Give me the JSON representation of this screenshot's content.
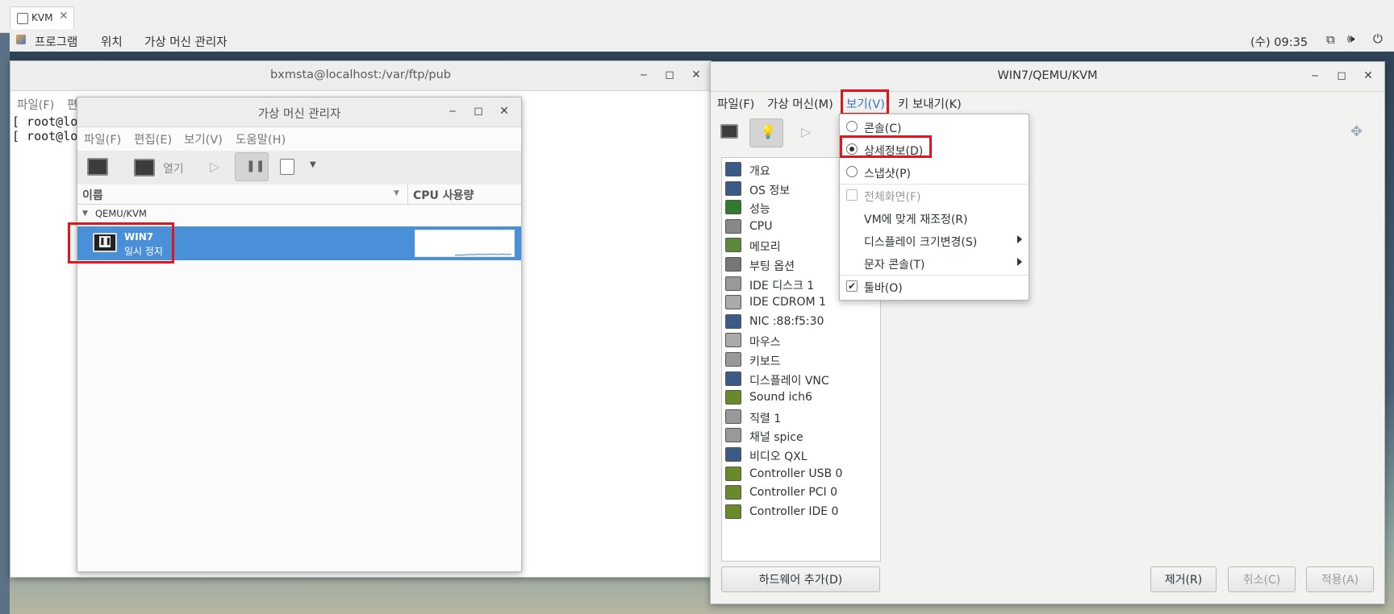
{
  "browser": {
    "tab_label": "KVM"
  },
  "topbar": {
    "apps": "프로그램",
    "places": "위치",
    "app_name": "가상 머신 관리자",
    "clock": "(수) 09:35"
  },
  "terminal": {
    "title": "bxmsta@localhost:/var/ftp/pub",
    "menu": [
      "파일(F)",
      "편"
    ],
    "lines": [
      "[ root@loca",
      "[ root@loca"
    ]
  },
  "vmm": {
    "title": "가상 머신 관리자",
    "menu": [
      "파일(F)",
      "편집(E)",
      "보기(V)",
      "도움말(H)"
    ],
    "toolbar_open": "열기",
    "columns": {
      "name": "이름",
      "cpu": "CPU 사용량"
    },
    "group": "QEMU/KVM",
    "vm": {
      "name": "WIN7",
      "status": "일시 정지"
    },
    "cpu_sparkline": [
      1,
      2,
      1,
      3,
      4,
      3,
      5,
      4,
      4,
      5,
      5,
      4,
      5,
      5,
      4,
      5
    ]
  },
  "vmwin": {
    "title": "WIN7/QEMU/KVM",
    "menu": [
      "파일(F)",
      "가상 머신(M)",
      "보기(V)",
      "키 보내기(K)"
    ],
    "hardware": [
      "개요",
      "OS 정보",
      "성능",
      "CPU",
      "메모리",
      "부팅 옵션",
      "IDE 디스크 1",
      "IDE CDROM 1",
      "NIC :88:f5:30",
      "마우스",
      "키보드",
      "디스플레이 VNC",
      "Sound ich6",
      "직렬 1",
      "채널 spice",
      "비디오 QXL",
      "Controller USB 0",
      "Controller PCI 0",
      "Controller IDE 0"
    ],
    "add_hardware": "하드웨어 추가(D)",
    "remove": "제거(R)",
    "cancel": "취소(C)",
    "apply": "적용(A)"
  },
  "view_menu": {
    "console": "콘솔(C)",
    "details": "상세정보(D)",
    "snapshot": "스냅샷(P)",
    "fullscreen": "전체화면(F)",
    "resize_to_vm": "VM에 맞게 재조정(R)",
    "scale_display": "디스플레이 크기변경(S)",
    "text_console": "문자 콘솔(T)",
    "toolbar": "툴바(O)",
    "selected": "상세정보(D)"
  },
  "colors": {
    "selection": "#4a90d9",
    "highlight_box": "#e2141c",
    "sparkline": "#5b8fc8"
  }
}
